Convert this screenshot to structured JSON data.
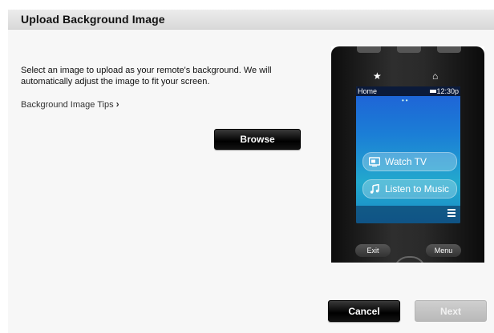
{
  "dialog": {
    "title": "Upload Background Image",
    "description": "Select an image to upload as your remote's background. We will automatically adjust the image to fit your screen.",
    "tips_link": "Background Image Tips",
    "tips_chevron": "›",
    "browse_label": "Browse",
    "cancel_label": "Cancel",
    "next_label": "Next"
  },
  "remote_preview": {
    "status_left": "Home",
    "status_time": "12:30",
    "status_suffix": "p",
    "items": [
      {
        "label": "Watch TV",
        "icon": "tv-icon"
      },
      {
        "label": "Listen to Music",
        "icon": "music-icon"
      }
    ],
    "softkey_left": "Exit",
    "softkey_right": "Menu",
    "icons": [
      "star-icon",
      "home-icon",
      "menu-icon"
    ]
  },
  "colors": {
    "header_bg": "#e3e3e3",
    "button_dark": "#000000",
    "button_disabled": "#c4c4c4",
    "screen_blue": "#1b7ed6"
  }
}
